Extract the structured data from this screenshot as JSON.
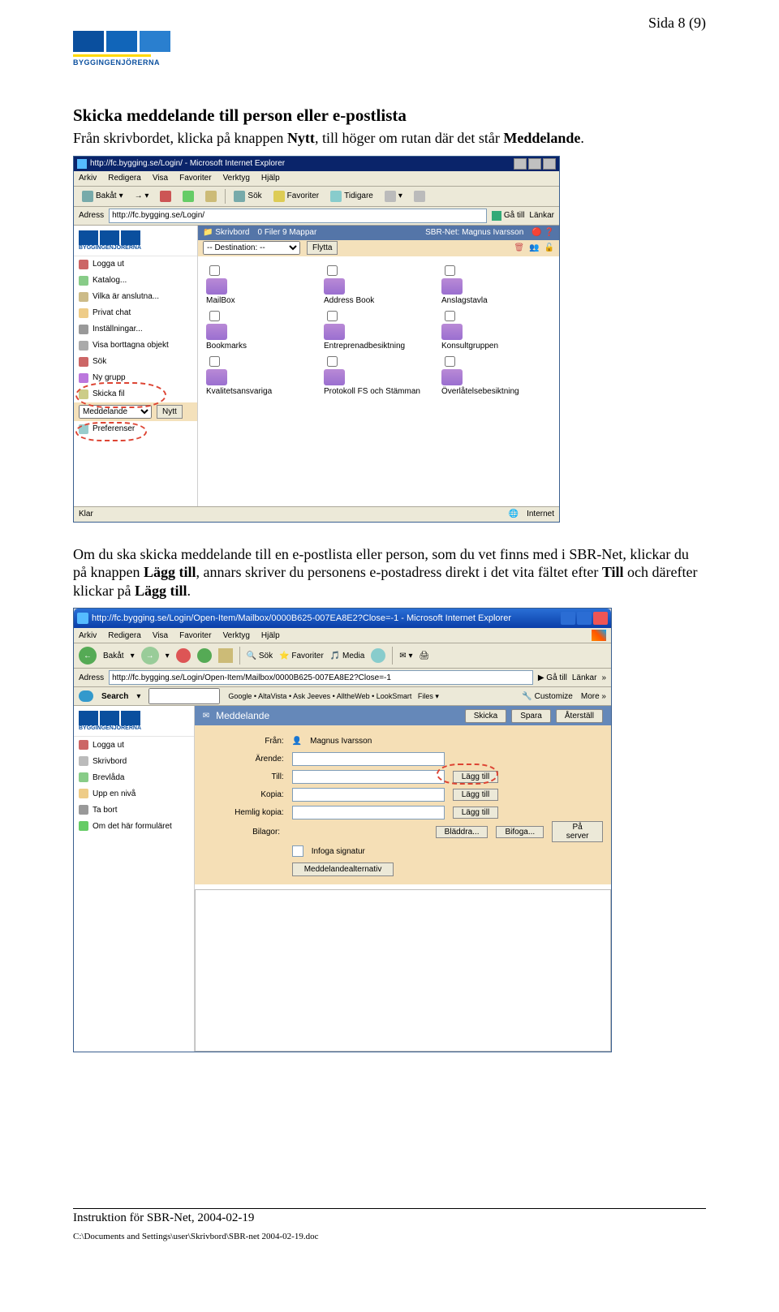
{
  "page_number": "Sida 8 (9)",
  "logo_text": "BYGGINGENJÖRERNA",
  "section1": {
    "title": "Skicka meddelande till person eller e-postlista",
    "para_pre": "Från skrivbordet, klicka på knappen ",
    "nytt": "Nytt",
    "para_mid": ", till höger om rutan där det står ",
    "meddelande": "Meddelande",
    "para_end": "."
  },
  "shot1": {
    "title": "http://fc.bygging.se/Login/ - Microsoft Internet Explorer",
    "menu": [
      "Arkiv",
      "Redigera",
      "Visa",
      "Favoriter",
      "Verktyg",
      "Hjälp"
    ],
    "toolbar_items": [
      "Bakåt",
      "Sök",
      "Favoriter",
      "Tidigare"
    ],
    "address_label": "Adress",
    "address": "http://fc.bygging.se/Login/",
    "go": "Gå till",
    "links": "Länkar",
    "sidebar": {
      "items": [
        "Logga ut",
        "Katalog...",
        "Vilka är anslutna...",
        "Privat chat",
        "Inställningar...",
        "Visa borttagna objekt",
        "Sök",
        "Ny grupp",
        "Skicka fil"
      ],
      "select_value": "Meddelande",
      "nytt_btn": "Nytt",
      "last": "Preferenser"
    },
    "desk_header": {
      "left": "Skrivbord",
      "center": "0 Filer  9 Mappar",
      "right": "SBR-Net: Magnus Ivarsson"
    },
    "dest_select": "-- Destination: --",
    "flytta": "Flytta",
    "folders": [
      "MailBox",
      "Address Book",
      "Anslagstavla",
      "Bookmarks",
      "Entreprenadbesiktning",
      "Konsultgruppen",
      "Kvalitetsansvariga",
      "Protokoll FS och Stämman",
      "Överlåtelsebesiktning"
    ],
    "status_left": "Klar",
    "status_right": "Internet"
  },
  "section2": {
    "text_a": "Om du ska skicka meddelande till en e-postlista eller person, som du vet finns med i SBR-Net, klickar du på knappen ",
    "lagg_till": "Lägg till",
    "text_b": ", annars skriver du personens e-postadress direkt i det vita fältet efter ",
    "till": "Till",
    "text_c": " och därefter klickar på ",
    "lagg_till2": "Lägg till",
    "text_d": "."
  },
  "shot2": {
    "title": "http://fc.bygging.se/Login/Open-Item/Mailbox/0000B625-007EA8E2?Close=-1 - Microsoft Internet Explorer",
    "menu": [
      "Arkiv",
      "Redigera",
      "Visa",
      "Favoriter",
      "Verktyg",
      "Hjälp"
    ],
    "toolbar_items": [
      "Bakåt",
      "Sök",
      "Favoriter",
      "Media"
    ],
    "address_label": "Adress",
    "address": "http://fc.bygging.se/Login/Open-Item/Mailbox/0000B625-007EA8E2?Close=-1",
    "go": "Gå till",
    "links": "Länkar",
    "search_label": "Search",
    "search_items": [
      "Google",
      "AltaVista",
      "Ask Jeeves",
      "AlltheWeb",
      "LookSmart",
      "Files"
    ],
    "customize": "Customize",
    "more": "More",
    "sidebar_items": [
      "Logga ut",
      "Skrivbord",
      "Brevlåda",
      "Upp en nivå",
      "Ta bort",
      "Om det här formuläret"
    ],
    "msg_title": "Meddelande",
    "btn_skicka": "Skicka",
    "btn_spara": "Spara",
    "btn_aterstall": "Återställ",
    "from_label": "Från:",
    "from_value": "Magnus Ivarsson",
    "subject_label": "Ärende:",
    "to_label": "Till:",
    "cc_label": "Kopia:",
    "bcc_label": "Hemlig kopia:",
    "add_btn": "Lägg till",
    "attach_label": "Bilagor:",
    "browse": "Bläddra...",
    "attach": "Bifoga...",
    "onserver": "På server",
    "sig_label": "Infoga signatur",
    "options_btn": "Meddelandealternativ"
  },
  "footer": {
    "line1": "Instruktion för SBR-Net, 2004-02-19",
    "line2": "C:\\Documents and Settings\\user\\Skrivbord\\SBR-net 2004-02-19.doc"
  }
}
